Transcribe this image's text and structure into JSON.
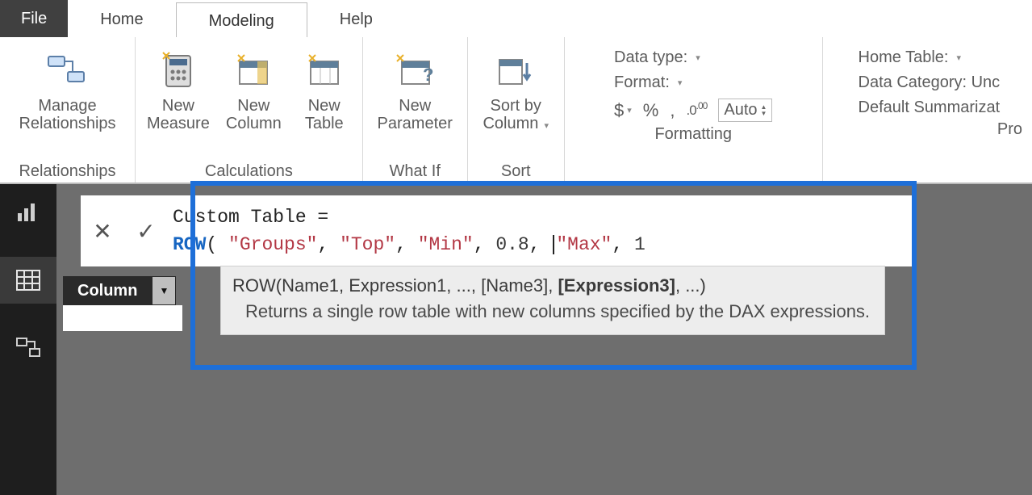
{
  "tabs": {
    "file": "File",
    "home": "Home",
    "modeling": "Modeling",
    "help": "Help"
  },
  "ribbon": {
    "manage_rel": "Manage\nRelationships",
    "new_measure": "New\nMeasure",
    "new_column": "New\nColumn",
    "new_table": "New\nTable",
    "new_param": "New\nParameter",
    "sort_by": "Sort by\nColumn",
    "grp_relationships": "Relationships",
    "grp_calculations": "Calculations",
    "grp_whatif": "What If",
    "grp_sort": "Sort",
    "grp_formatting": "Formatting",
    "grp_pro": "Pro"
  },
  "props": {
    "data_type": "Data type:",
    "format": "Format:",
    "currency": "$",
    "percent": "%",
    "comma": ",",
    "decimals": ".00",
    "auto": "Auto",
    "home_table": "Home Table:",
    "data_category": "Data Category: Unc",
    "default_summ": "Default Summarizat"
  },
  "fields_pane": {
    "column": "Column"
  },
  "formula": {
    "line1": "Custom Table =",
    "kw": "ROW",
    "paren_open": "( ",
    "s_groups": "\"Groups\"",
    "s_top": "\"Top\"",
    "s_min": "\"Min\"",
    "n_08": "0.8",
    "s_max": "\"Max\"",
    "n_1": "1",
    "comma": ", "
  },
  "tooltip": {
    "sig_prefix": "ROW(Name1, Expression1, ..., [Name3], ",
    "sig_bold": "[Expression3]",
    "sig_suffix": ", ...)",
    "desc": "Returns a single row table with new columns specified by the DAX expressions."
  }
}
